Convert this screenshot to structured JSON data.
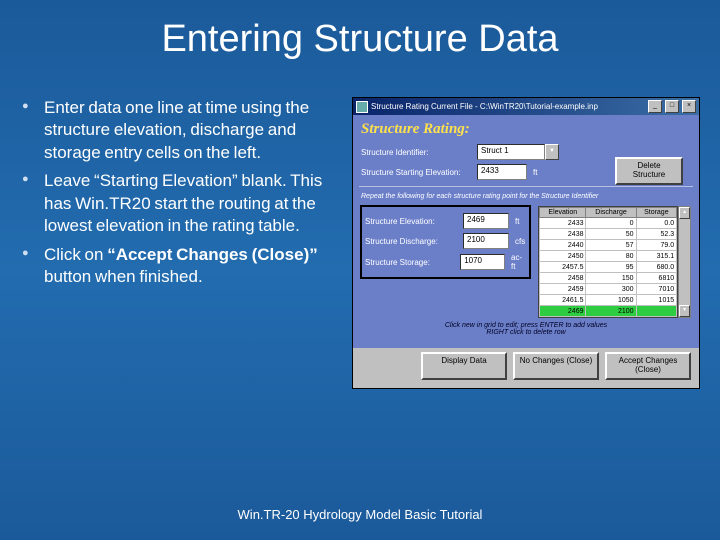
{
  "title": "Entering Structure Data",
  "bullets": [
    "Enter data one line at time using the structure elevation, discharge and storage entry cells on the left.",
    "Leave “Starting Elevation” blank.  This has Win.TR20 start the routing at the lowest elevation in the rating table.",
    "Click on “Accept Changes (Close)” button when finished."
  ],
  "bold_span": "“Accept Changes (Close)”",
  "window": {
    "title": "Structure Rating   Current File - C:\\WinTR20\\Tutorial-example.inp",
    "heading": "Structure Rating:",
    "fields": {
      "id_label": "Structure Identifier:",
      "id_value": "Struct 1",
      "start_elev_label": "Structure Starting Elevation:",
      "start_elev_value": "2433",
      "start_elev_unit": "ft",
      "elev_label": "Structure Elevation:",
      "elev_value": "2469",
      "elev_unit": "ft",
      "disch_label": "Structure Discharge:",
      "disch_value": "2100",
      "disch_unit": "cfs",
      "store_label": "Structure Storage:",
      "store_value": "1070",
      "store_unit": "ac-ft"
    },
    "delete_btn": "Delete Structure",
    "instr": "Repeat the following for each structure rating point for the Structure Identifier",
    "hint": "Click new in grid to edit; press ENTER to add values\nRIGHT click to delete row",
    "table": {
      "headers": [
        "Elevation",
        "Discharge",
        "Storage"
      ],
      "rows": [
        [
          "2433",
          "0",
          "0.0"
        ],
        [
          "2438",
          "50",
          "52.3"
        ],
        [
          "2440",
          "57",
          "79.0"
        ],
        [
          "2450",
          "80",
          "315.1"
        ],
        [
          "2457.5",
          "95",
          "680.0"
        ],
        [
          "2458",
          "150",
          "6810"
        ],
        [
          "2459",
          "300",
          "7010"
        ],
        [
          "2461.5",
          "1050",
          "1015"
        ]
      ],
      "hi_row": [
        "2469",
        "2100",
        ""
      ]
    },
    "buttons": {
      "display": "Display Data",
      "nochg": "No Changes (Close)",
      "accept": "Accept Changes (Close)"
    }
  },
  "footer": "Win.TR-20 Hydrology Model Basic Tutorial"
}
